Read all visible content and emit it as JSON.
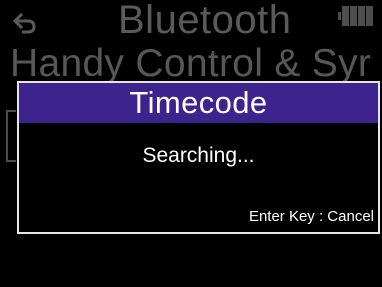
{
  "background": {
    "title": "Bluetooth",
    "subtitle": "Handy Control & Syr",
    "back_icon": "back-arrow-icon",
    "battery_icon": "battery-icon"
  },
  "dialog": {
    "title": "Timecode",
    "message": "Searching...",
    "footer_hint": "Enter Key : Cancel"
  },
  "colors": {
    "screen_bg": "#000000",
    "dialog_header_bg": "#3d238e",
    "dialog_border": "#e6e6e6",
    "dimmed_text": "#5a5a5a",
    "text": "#ffffff"
  }
}
